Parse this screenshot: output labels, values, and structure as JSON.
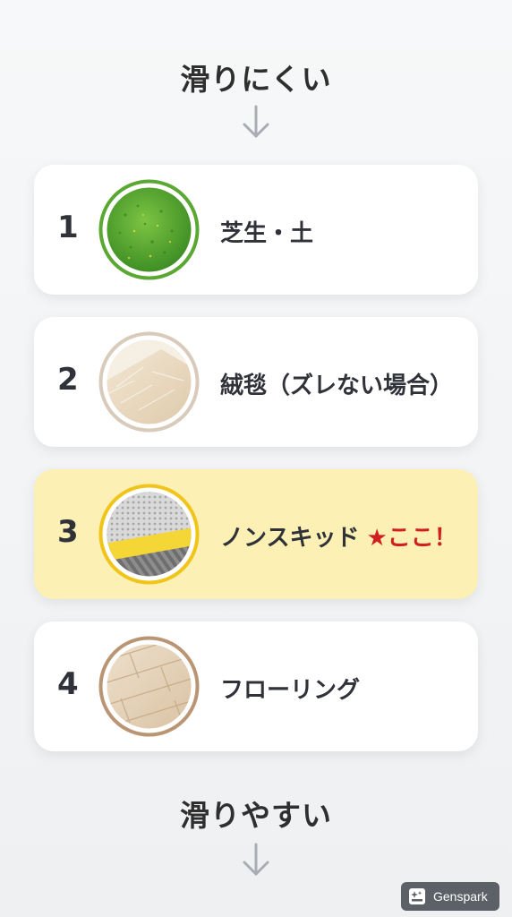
{
  "top_label": "滑りにくい",
  "bottom_label": "滑りやすい",
  "items": [
    {
      "rank": "1",
      "label": "芝生・土",
      "accent": "",
      "icon": "grass-swatch-icon"
    },
    {
      "rank": "2",
      "label": "絨毯（ズレない場合）",
      "accent": "",
      "icon": "carpet-swatch-icon"
    },
    {
      "rank": "3",
      "label": "ノンスキッド",
      "accent": "★ここ！",
      "icon": "nonskid-swatch-icon"
    },
    {
      "rank": "4",
      "label": "フローリング",
      "accent": "",
      "icon": "flooring-swatch-icon"
    }
  ],
  "watermark": "Genspark",
  "colors": {
    "highlight": "#fcf0b4",
    "accent": "#d11f1f",
    "grass_ring": "#5aa832",
    "nonskid_ring": "#f0c419"
  }
}
